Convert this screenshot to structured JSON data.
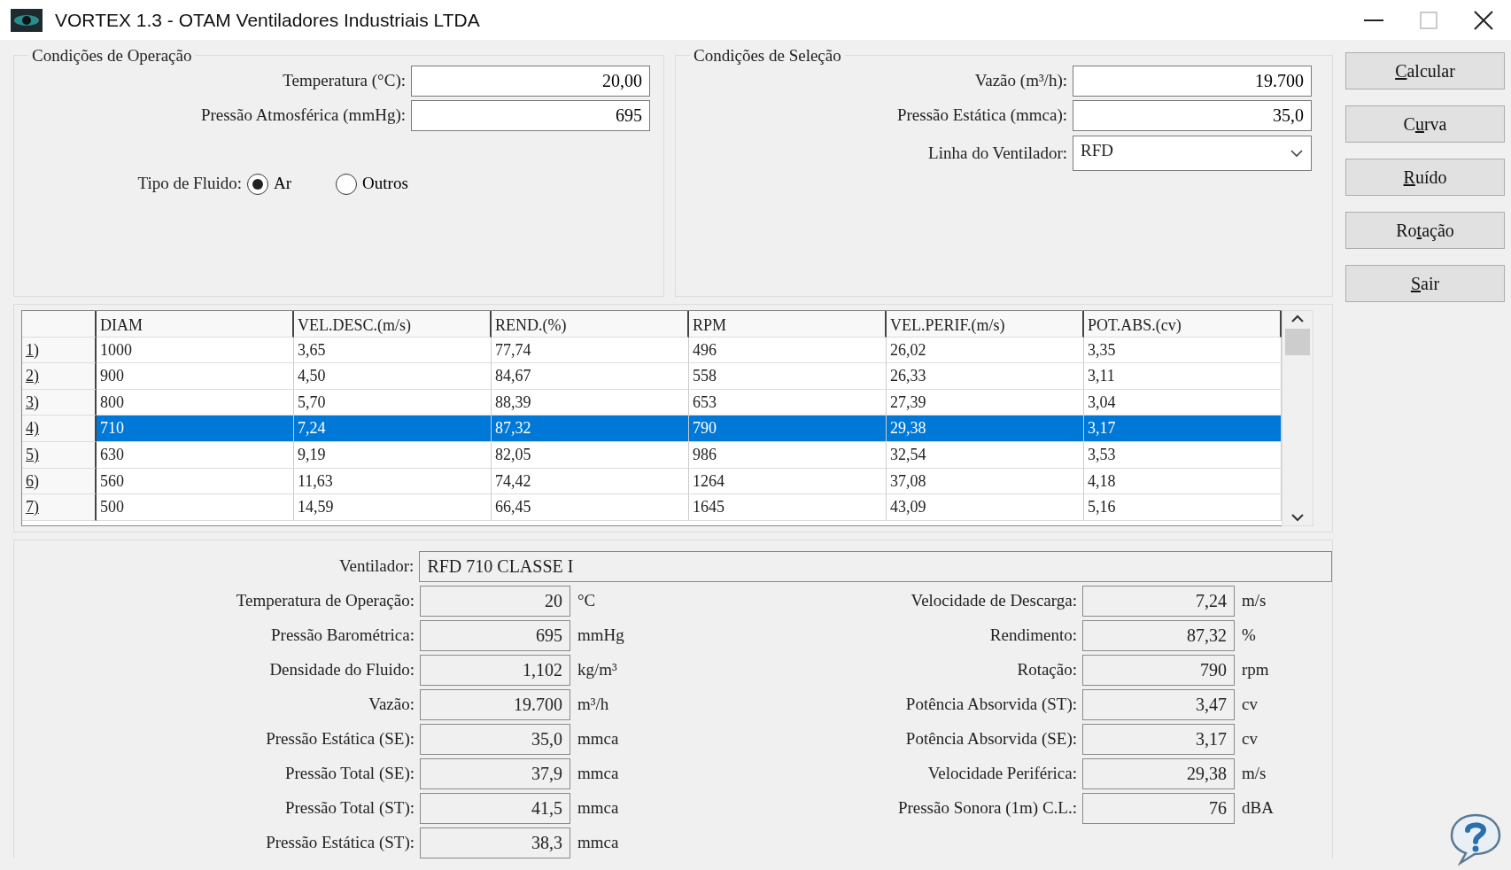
{
  "window": {
    "title": "VORTEX 1.3 - OTAM Ventiladores Industriais LTDA"
  },
  "operation_conditions": {
    "title": "Condições de Operação",
    "fields": [
      {
        "label": "Temperatura (°C):",
        "value": "20,00"
      },
      {
        "label": "Pressão Atmosférica (mmHg):",
        "value": "695"
      }
    ],
    "fluid_type": {
      "label": "Tipo de Fluido:",
      "options": [
        {
          "label": "Ar",
          "selected": true
        },
        {
          "label": "Outros",
          "selected": false
        }
      ]
    }
  },
  "selection_conditions": {
    "title": "Condições de Seleção",
    "fields": [
      {
        "kind": "text",
        "label": "Vazão (m³/h):",
        "value": "19.700"
      },
      {
        "kind": "text",
        "label": "Pressão Estática (mmca):",
        "value": "35,0"
      },
      {
        "kind": "dropdown",
        "label": "Linha do Ventilador:",
        "value": "RFD"
      }
    ]
  },
  "buttons": [
    {
      "key": "C",
      "post": "alcular"
    },
    {
      "pre": "C",
      "key": "u",
      "post": "rva"
    },
    {
      "key": "R",
      "post": "uído"
    },
    {
      "pre": "Ro",
      "key": "t",
      "post": "ação"
    },
    {
      "key": "S",
      "post": "air"
    }
  ],
  "table": {
    "columns": [
      "DIAM",
      "VEL.DESC.(m/s)",
      "REND.(%)",
      "RPM",
      "VEL.PERIF.(m/s)",
      "POT.ABS.(cv)"
    ],
    "rows": [
      {
        "header": "1)",
        "selected": false,
        "cells": [
          "1000",
          "3,65",
          "77,74",
          "496",
          "26,02",
          "3,35"
        ]
      },
      {
        "header": "2)",
        "selected": false,
        "cells": [
          "900",
          "4,50",
          "84,67",
          "558",
          "26,33",
          "3,11"
        ]
      },
      {
        "header": "3)",
        "selected": false,
        "cells": [
          "800",
          "5,70",
          "88,39",
          "653",
          "27,39",
          "3,04"
        ]
      },
      {
        "header": "4)",
        "selected": true,
        "cells": [
          "710",
          "7,24",
          "87,32",
          "790",
          "29,38",
          "3,17"
        ]
      },
      {
        "header": "5)",
        "selected": false,
        "cells": [
          "630",
          "9,19",
          "82,05",
          "986",
          "32,54",
          "3,53"
        ]
      },
      {
        "header": "6)",
        "selected": false,
        "cells": [
          "560",
          "11,63",
          "74,42",
          "1264",
          "37,08",
          "4,18"
        ]
      },
      {
        "header": "7)",
        "selected": false,
        "cells": [
          "500",
          "14,59",
          "66,45",
          "1645",
          "43,09",
          "5,16"
        ]
      }
    ]
  },
  "result": {
    "fan": {
      "label": "Ventilador:",
      "value": "RFD 710 CLASSE I"
    },
    "left": [
      {
        "label": "Temperatura de Operação:",
        "value": "20",
        "unit": "°C"
      },
      {
        "label": "Pressão Barométrica:",
        "value": "695",
        "unit": "mmHg"
      },
      {
        "label": "Densidade do Fluido:",
        "value": "1,102",
        "unit": "kg/m³"
      },
      {
        "label": "Vazão:",
        "value": "19.700",
        "unit": "m³/h"
      },
      {
        "label": "Pressão Estática (SE):",
        "value": "35,0",
        "unit": "mmca"
      },
      {
        "label": "Pressão Total (SE):",
        "value": "37,9",
        "unit": "mmca"
      },
      {
        "label": "Pressão Total (ST):",
        "value": "41,5",
        "unit": "mmca"
      },
      {
        "label": "Pressão Estática (ST):",
        "value": "38,3",
        "unit": "mmca"
      }
    ],
    "right": [
      {
        "label": "Velocidade de Descarga:",
        "value": "7,24",
        "unit": "m/s"
      },
      {
        "label": "Rendimento:",
        "value": "87,32",
        "unit": "%"
      },
      {
        "label": "Rotação:",
        "value": "790",
        "unit": "rpm"
      },
      {
        "label": "Potência Absorvida (ST):",
        "value": "3,47",
        "unit": "cv"
      },
      {
        "label": "Potência Absorvida (SE):",
        "value": "3,17",
        "unit": "cv"
      },
      {
        "label": "Velocidade Periférica:",
        "value": "29,38",
        "unit": "m/s"
      },
      {
        "label": "Pressão Sonora (1m) C.L.:",
        "value": "76",
        "unit": "dBA"
      }
    ]
  }
}
